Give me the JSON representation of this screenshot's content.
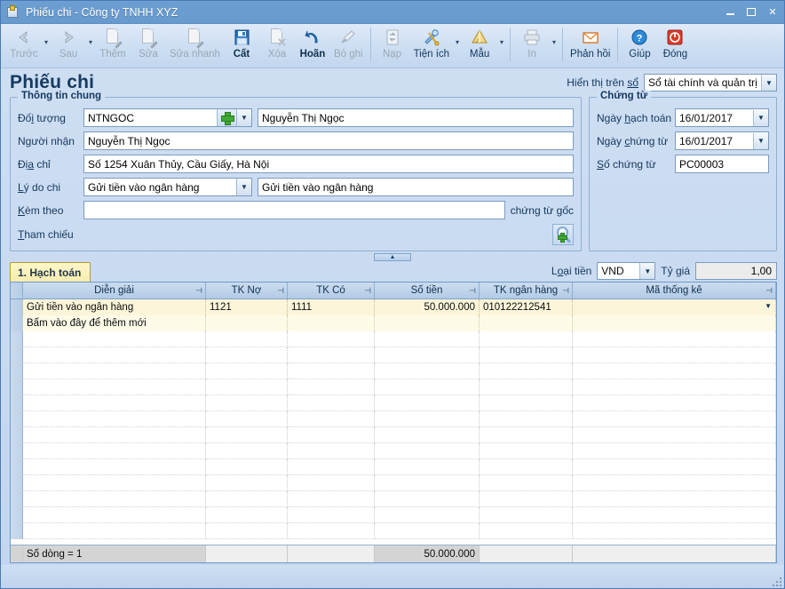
{
  "window": {
    "title": "Phiếu chi - Công ty TNHH XYZ",
    "icon": "voucher-icon",
    "minimize": "–",
    "maximize": "□",
    "close": "✕"
  },
  "toolbar": {
    "items": [
      {
        "label": "Trước",
        "icon": "arrow-left-icon",
        "disabled": true,
        "caret": true
      },
      {
        "label": "Sau",
        "icon": "arrow-right-icon",
        "disabled": true,
        "caret": true
      },
      {
        "label": "Thêm",
        "icon": "add-document-icon",
        "disabled": true,
        "caret": false
      },
      {
        "label": "Sửa",
        "icon": "edit-document-icon",
        "disabled": true,
        "caret": false
      },
      {
        "label": "Sửa nhanh",
        "icon": "quick-edit-icon",
        "disabled": true,
        "caret": false
      },
      {
        "label": "Cất",
        "icon": "save-floppy-icon",
        "disabled": false,
        "caret": false,
        "bold": true
      },
      {
        "label": "Xóa",
        "icon": "delete-document-icon",
        "disabled": true,
        "caret": false
      },
      {
        "label": "Hoãn",
        "icon": "undo-arrow-icon",
        "disabled": false,
        "caret": false,
        "bold": true
      },
      {
        "label": "Bỏ ghi",
        "icon": "unpost-pencil-icon",
        "disabled": true,
        "caret": false
      },
      {
        "label": "Nạp",
        "icon": "refresh-icon",
        "disabled": true,
        "caret": false
      },
      {
        "label": "Tiện ích",
        "icon": "tools-wrench-icon",
        "disabled": false,
        "caret": true
      },
      {
        "label": "Mẫu",
        "icon": "ruler-template-icon",
        "disabled": false,
        "caret": true
      },
      {
        "label": "In",
        "icon": "printer-icon",
        "disabled": true,
        "caret": true
      },
      {
        "label": "Phản hồi",
        "icon": "envelope-icon",
        "disabled": false,
        "caret": false
      },
      {
        "label": "Giúp",
        "icon": "help-question-icon",
        "disabled": false,
        "caret": false
      },
      {
        "label": "Đóng",
        "icon": "power-close-icon",
        "disabled": false,
        "caret": false
      }
    ]
  },
  "page": {
    "title": "Phiếu chi",
    "display_book_label": "Hiển thị trên sổ",
    "display_book_value": "Sổ tài chính và quản trị"
  },
  "general": {
    "legend": "Thông tin chung",
    "object_label": "Đối tượng",
    "object_code": "NTNGOC",
    "object_name": "Nguyễn Thị Ngọc",
    "receiver_label": "Người nhận",
    "receiver_value": "Nguyễn Thị Ngọc",
    "address_label": "Địa chỉ",
    "address_value": "Số 1254 Xuân Thủy, Cầu Giấy, Hà Nội",
    "reason_label": "Lý do chi",
    "reason_code": "Gửi tiền vào ngân hàng",
    "reason_text": "Gửi tiền vào ngân hàng",
    "attach_label": "Kèm theo",
    "attach_value": "",
    "attach_suffix": "chứng từ gốc",
    "reference_label": "Tham chiếu",
    "reference_button_icon": "lookup-add-icon"
  },
  "voucher": {
    "legend": "Chứng từ",
    "posting_date_label": "Ngày hạch toán",
    "posting_date_value": "16/01/2017",
    "voucher_date_label": "Ngày chứng từ",
    "voucher_date_value": "16/01/2017",
    "voucher_no_label": "Số chứng từ",
    "voucher_no_value": "PC00003"
  },
  "splitter": {
    "icon": "collapse-chevron-up-icon"
  },
  "tabs": [
    {
      "label": "1. Hạch toán",
      "active": true
    }
  ],
  "currency": {
    "type_label": "Loại tiền",
    "type_value": "VND",
    "rate_label": "Tỷ giá",
    "rate_value": "1,00"
  },
  "grid": {
    "columns": [
      {
        "key": "dien_giai",
        "label": "Diễn giải"
      },
      {
        "key": "tk_no",
        "label": "TK Nợ"
      },
      {
        "key": "tk_co",
        "label": "TK Có"
      },
      {
        "key": "so_tien",
        "label": "Số tiền"
      },
      {
        "key": "tk_ngan_hang",
        "label": "TK ngân hàng"
      },
      {
        "key": "ma_thong_ke",
        "label": "Mã thống kê"
      }
    ],
    "rows": [
      {
        "dien_giai": "Gửi tiền vào ngân hàng",
        "tk_no": "1121",
        "tk_co": "1111",
        "so_tien": "50.000.000",
        "tk_ngan_hang": "010122212541",
        "ma_thong_ke": ""
      }
    ],
    "new_row_hint": "Bấm vào đây để thêm mới",
    "empty_row_count": 13,
    "footer": {
      "row_count_label": "Số dòng = 1",
      "total_amount": "50.000.000"
    }
  }
}
